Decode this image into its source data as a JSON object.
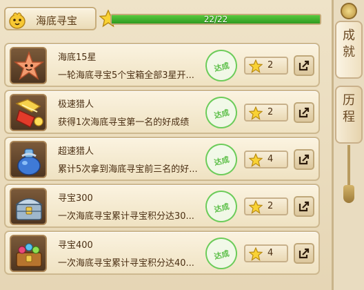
{
  "header": {
    "title": "海底寻宝",
    "progress_text": "22/22",
    "progress_fraction": 1.0
  },
  "achievements": [
    {
      "name": "海底15星",
      "desc": "一轮海底寻宝5个宝箱全部3星开...",
      "stamp": "达成",
      "reward": "2",
      "icon": "starfish-icon"
    },
    {
      "name": "极速猎人",
      "desc": "获得1次海底寻宝第一名的好成绩",
      "stamp": "达成",
      "reward": "2",
      "icon": "golden-hammer-icon"
    },
    {
      "name": "超速猎人",
      "desc": "累计5次拿到海底寻宝前三名的好...",
      "stamp": "达成",
      "reward": "4",
      "icon": "potion-bag-icon"
    },
    {
      "name": "寻宝300",
      "desc": "一次海底寻宝累计寻宝积分达30...",
      "stamp": "达成",
      "reward": "2",
      "icon": "silver-chest-icon"
    },
    {
      "name": "寻宝400",
      "desc": "一次海底寻宝累计寻宝积分达40...",
      "stamp": "达成",
      "reward": "4",
      "icon": "jewel-chest-icon"
    }
  ],
  "side_tabs": {
    "achievement": "成就",
    "history": "历程"
  },
  "colors": {
    "progress_green": "#3fae2a",
    "stamp_green": "#5bbf48",
    "text_brown": "#4a2e12"
  }
}
